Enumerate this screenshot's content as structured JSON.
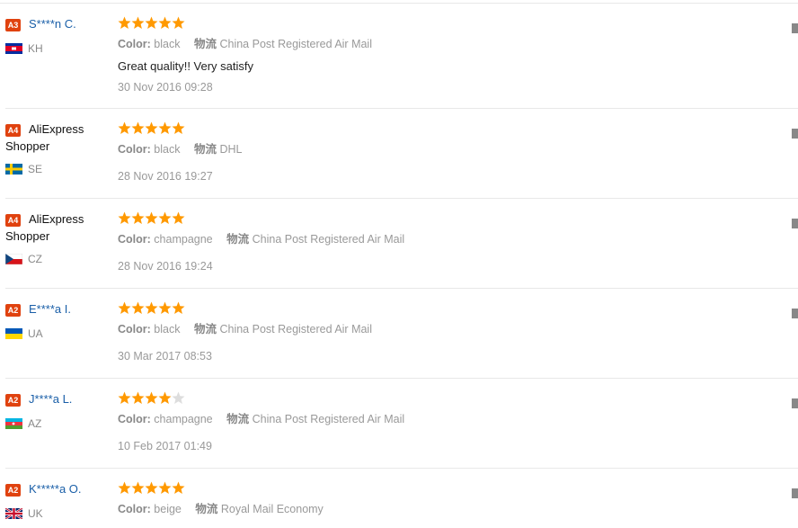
{
  "colors": {
    "accent": "#e0420f",
    "star_fill": "#ff9900",
    "star_empty": "#dddddd",
    "link": "#1a5fa8"
  },
  "labels": {
    "color": "Color:",
    "shipping": "物流"
  },
  "reviews": [
    {
      "badge": "A3",
      "buyer": "S****n C.",
      "anonymous": false,
      "country": "KH",
      "flag_icon": "cambodia-flag-icon",
      "rating": 5,
      "color": "black",
      "shipping": "China Post Registered Air Mail",
      "feedback": "Great quality!! Very satisfy",
      "date": "30 Nov 2016 09:28"
    },
    {
      "badge": "A4",
      "buyer": "AliExpress Shopper",
      "anonymous": true,
      "country": "SE",
      "flag_icon": "sweden-flag-icon",
      "rating": 5,
      "color": "black",
      "shipping": "DHL",
      "feedback": "",
      "date": "28 Nov 2016 19:27"
    },
    {
      "badge": "A4",
      "buyer": "AliExpress Shopper",
      "anonymous": true,
      "country": "CZ",
      "flag_icon": "czech-flag-icon",
      "rating": 5,
      "color": "champagne",
      "shipping": "China Post Registered Air Mail",
      "feedback": "",
      "date": "28 Nov 2016 19:24"
    },
    {
      "badge": "A2",
      "buyer": "E****a I.",
      "anonymous": false,
      "country": "UA",
      "flag_icon": "ukraine-flag-icon",
      "rating": 5,
      "color": "black",
      "shipping": "China Post Registered Air Mail",
      "feedback": "",
      "date": "30 Mar 2017 08:53"
    },
    {
      "badge": "A2",
      "buyer": "J****a L.",
      "anonymous": false,
      "country": "AZ",
      "flag_icon": "azerbaijan-flag-icon",
      "rating": 4,
      "color": "champagne",
      "shipping": "China Post Registered Air Mail",
      "feedback": "",
      "date": "10 Feb 2017 01:49"
    },
    {
      "badge": "A2",
      "buyer": "K*****a O.",
      "anonymous": false,
      "country": "UK",
      "flag_icon": "uk-flag-icon",
      "rating": 5,
      "color": "beige",
      "shipping": "Royal Mail Economy",
      "feedback": "",
      "date": ""
    }
  ]
}
